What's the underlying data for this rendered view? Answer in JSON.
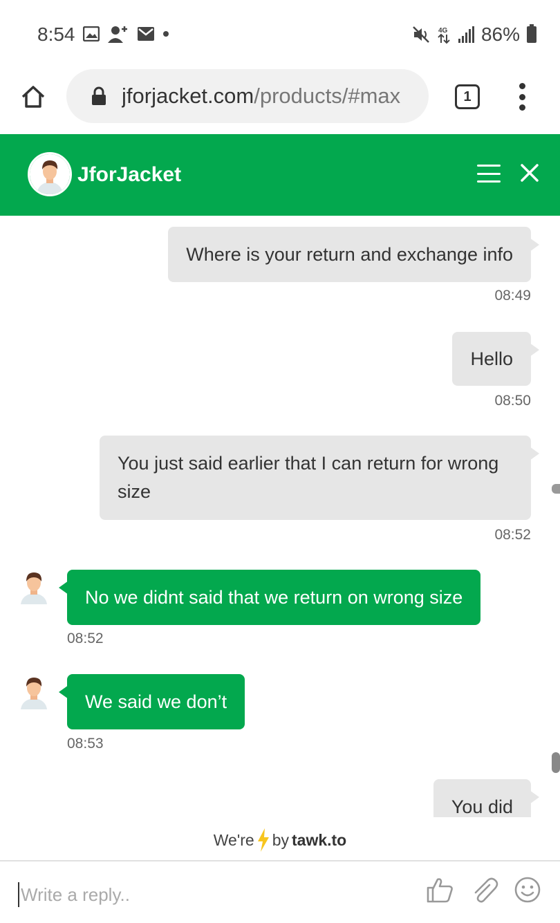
{
  "status_bar": {
    "time": "8:54",
    "battery": "86%",
    "icons_left": [
      "image-icon",
      "add-contact-icon",
      "mail-icon",
      "dot-icon"
    ],
    "icons_right": [
      "mute-icon",
      "data-icon",
      "signal-icon",
      "battery-icon"
    ]
  },
  "browser": {
    "url_host": "jforjacket.com",
    "url_path": "/products/#max",
    "tab_count": "1"
  },
  "chat": {
    "agent_name": "JforJacket",
    "colors": {
      "accent": "#03a84e",
      "visitor_bubble": "#e6e6e6"
    },
    "messages": [
      {
        "sender": "visitor",
        "text": "Where is your return and exchange info",
        "time": "08:49"
      },
      {
        "sender": "visitor",
        "text": "Hello",
        "time": "08:50"
      },
      {
        "sender": "visitor",
        "text": "You just said earlier that I can return for wrong size",
        "time": "08:52"
      },
      {
        "sender": "agent",
        "text": "No we didnt said that we return on wrong size",
        "time": "08:52"
      },
      {
        "sender": "agent",
        "text": "We said we don’t",
        "time": "08:53"
      },
      {
        "sender": "visitor",
        "text": "You did",
        "time": ""
      }
    ]
  },
  "footer": {
    "powered_prefix": "We're",
    "powered_by": "by",
    "brand": "tawk.to",
    "reply_placeholder": "Write a reply.."
  }
}
